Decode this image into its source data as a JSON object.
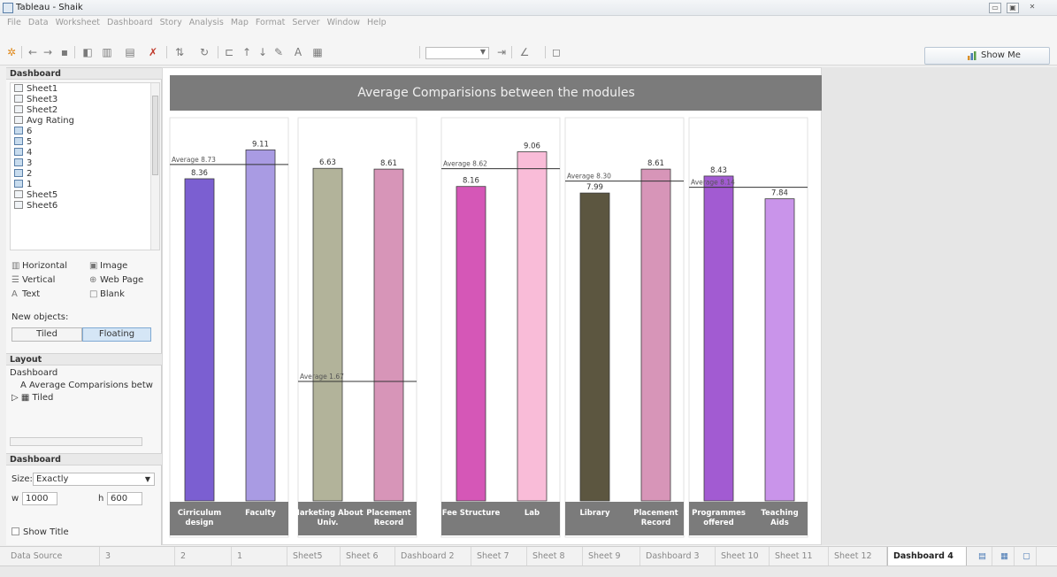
{
  "window": {
    "title": "Tableau - Shaik",
    "minimize": "▭",
    "restore": "▣",
    "close": "✕"
  },
  "menu": [
    "File",
    "Data",
    "Worksheet",
    "Dashboard",
    "Story",
    "Analysis",
    "Map",
    "Format",
    "Server",
    "Window",
    "Help"
  ],
  "toolbar": {
    "show_me": "Show Me",
    "icons": [
      "tableau-logo-icon",
      "undo-icon",
      "redo-icon",
      "save-icon",
      "new-datasource-icon",
      "new-worksheet-icon",
      "duplicate-sheet-icon",
      "clear-sheet-icon",
      "swap-icon",
      "refresh-icon",
      "group-icon",
      "sort-asc-icon",
      "sort-desc-icon",
      "highlight-icon",
      "labels-icon",
      "fit-icon",
      "fix-axes-icon",
      "pen-icon",
      "presentation-icon"
    ]
  },
  "left_panel": {
    "dashboard_header": "Dashboard",
    "sheets": [
      "Sheet1",
      "Sheet3",
      "Sheet2",
      "Avg Rating",
      "6",
      "5",
      "4",
      "3",
      "2",
      "1",
      "Sheet5",
      "Sheet6"
    ],
    "objects": {
      "horizontal": "Horizontal",
      "image": "Image",
      "vertical": "Vertical",
      "web_page": "Web Page",
      "text": "Text",
      "blank": "Blank"
    },
    "new_objects_label": "New objects:",
    "tiled": "Tiled",
    "floating": "Floating",
    "layout_header": "Layout",
    "layout_root": "Dashboard",
    "layout_title_item": "Average Comparisions betw",
    "layout_tiled_item": "Tiled",
    "dashboard_header2": "Dashboard",
    "size_label": "Size:",
    "size_value": "Exactly",
    "w_label": "w",
    "w_value": "1000",
    "h_label": "h",
    "h_value": "600",
    "show_title": "Show Title"
  },
  "dashboard": {
    "title": "Average Comparisions between the modules"
  },
  "chart_data": {
    "type": "bar",
    "title": "Average Comparisions between the modules",
    "ylim": [
      0,
      9.6
    ],
    "grid": false,
    "panels": [
      {
        "categories": [
          "Cirriculum design",
          "Faculty"
        ],
        "values": [
          8.36,
          9.11
        ],
        "value_labels": [
          "8.36",
          "9.11"
        ],
        "colors": [
          "#7b5fd1",
          "#a99be3"
        ],
        "average": 8.73,
        "average_label": "Average 8.73"
      },
      {
        "categories": [
          "Marketing About Univ.",
          "Placement Record"
        ],
        "values": [
          8.63,
          8.61
        ],
        "value_labels": [
          "6.63",
          "8.61"
        ],
        "colors": [
          "#b2b39a",
          "#d795b8"
        ],
        "average": 3.1,
        "average_label": "Average 1.67"
      },
      {
        "categories": [
          "Fee Structure",
          "Lab"
        ],
        "values": [
          8.16,
          9.06
        ],
        "value_labels": [
          "8.16",
          "9.06"
        ],
        "colors": [
          "#d557b7",
          "#f9bcd8"
        ],
        "average": 8.62,
        "average_label": "Average 8.62"
      },
      {
        "categories": [
          "Library",
          "Placement Record"
        ],
        "values": [
          7.99,
          8.61
        ],
        "value_labels": [
          "7.99",
          "8.61"
        ],
        "colors": [
          "#5c5640",
          "#d795b8"
        ],
        "average": 8.3,
        "average_label": "Average 8.30"
      },
      {
        "categories": [
          "Programmes offered",
          "Teaching Aids"
        ],
        "values": [
          8.43,
          7.84
        ],
        "value_labels": [
          "8.43",
          "7.84"
        ],
        "colors": [
          "#a25bd2",
          "#c994ea"
        ],
        "average": 8.14,
        "average_label": "Average 8.14"
      }
    ]
  },
  "tabs": [
    "Data Source",
    "3",
    "2",
    "1",
    "Sheet5",
    "Sheet 6",
    "Dashboard 2",
    "Sheet 7",
    "Sheet 8",
    "Sheet 9",
    "Dashboard 3",
    "Sheet 10",
    "Sheet 11",
    "Sheet 12",
    "Dashboard 4"
  ],
  "active_tab": "Dashboard 4",
  "colors": {
    "title_bar_bg": "#7b7b7b",
    "category_band_bg": "#7b7b7b",
    "floating_active": "#d5e6f6"
  }
}
